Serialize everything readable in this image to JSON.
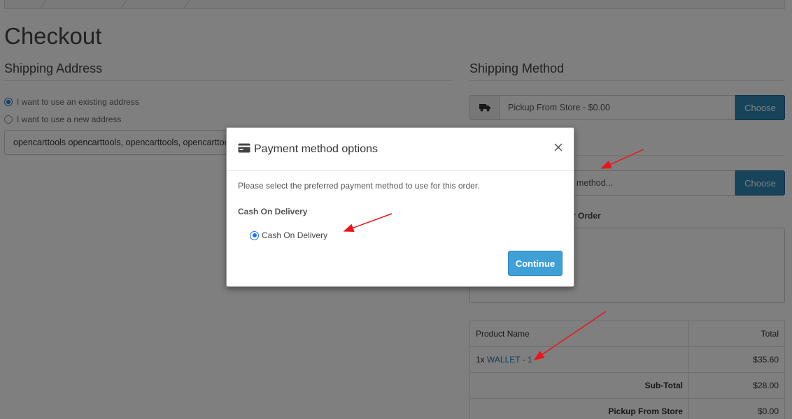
{
  "page": {
    "title": "Checkout"
  },
  "shipping_address": {
    "heading": "Shipping Address",
    "existing_label": "I want to use an existing address",
    "new_label": "I want to use a new address",
    "selected_address": "opencarttools opencarttools, opencarttools, opencarttools"
  },
  "shipping_method": {
    "heading": "Shipping Method",
    "value": "Pickup From Store - $0.00",
    "choose_label": "Choose",
    "icon": "truck-icon"
  },
  "payment_method": {
    "placeholder": "method...",
    "choose_label": "Choose"
  },
  "comment": {
    "label": "r Order"
  },
  "cart": {
    "header": {
      "product": "Product Name",
      "total": "Total"
    },
    "rows": [
      {
        "qty": "1x",
        "product": "WALLET - 1",
        "total": "$35.60"
      }
    ],
    "totals": [
      {
        "label": "Sub-Total",
        "value": "$28.00"
      },
      {
        "label": "Pickup From Store",
        "value": "$0.00"
      }
    ]
  },
  "modal": {
    "title": "Payment method options",
    "icon": "credit-card-icon",
    "description": "Please select the preferred payment method to use for this order.",
    "group_label": "Cash On Delivery",
    "option_label": "Cash On Delivery",
    "continue_label": "Continue"
  },
  "colors": {
    "primary_button": "#2f86b7",
    "continue_button": "#3fa0d6",
    "link": "#2a7ab0",
    "annotation_arrow": "#e8161b"
  }
}
